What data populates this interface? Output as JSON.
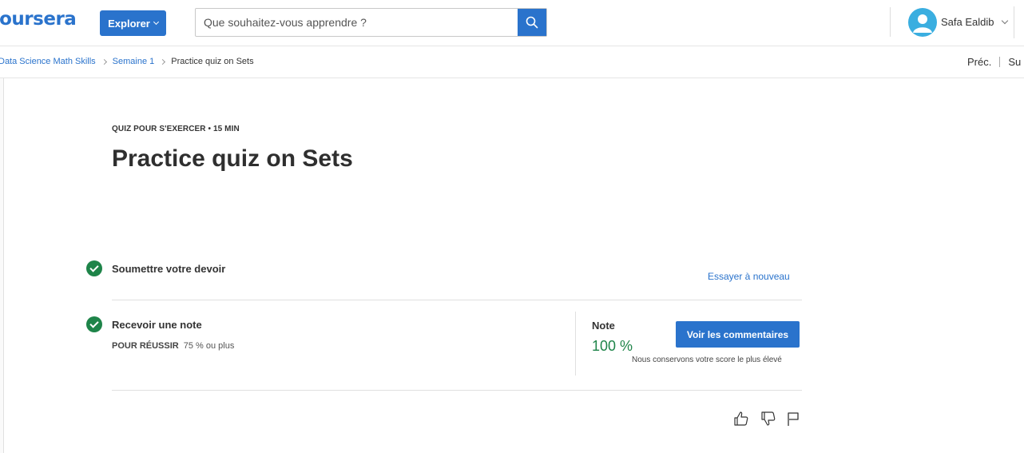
{
  "header": {
    "logo": "coursera",
    "explore_label": "Explorer",
    "search_placeholder": "Que souhaitez-vous apprendre ?",
    "user_name": "Safa Ealdib"
  },
  "breadcrumb": {
    "items": [
      "Data Science Math Skills",
      "Semaine 1",
      "Practice quiz on Sets"
    ],
    "prev_label": "Préc.",
    "next_label": "Su"
  },
  "quiz": {
    "eyebrow": "QUIZ POUR S'EXERCER • 15  MIN",
    "title": "Practice quiz on Sets",
    "step1_label": "Soumettre votre devoir",
    "retry_label": "Essayer à nouveau",
    "step2_label": "Recevoir une note",
    "pass_label": "POUR RÉUSSIR",
    "pass_value": "75 % ou plus",
    "grade_label": "Note",
    "grade_value": "100 %",
    "feedback_label": "Voir les commentaires",
    "keep_note": "Nous conservons votre score le plus élevé"
  },
  "colors": {
    "accent": "#2a73cc",
    "success": "#1e8449"
  },
  "icons": [
    "search-icon",
    "user-avatar-icon",
    "check-circle-icon",
    "thumbs-up-icon",
    "thumbs-down-icon",
    "flag-icon"
  ]
}
